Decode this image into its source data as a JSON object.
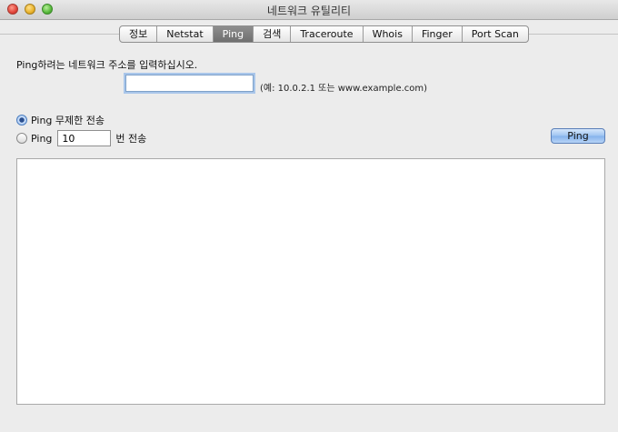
{
  "window": {
    "title": "네트워크 유틸리티"
  },
  "tabs": [
    {
      "label": "정보"
    },
    {
      "label": "Netstat"
    },
    {
      "label": "Ping"
    },
    {
      "label": "검색"
    },
    {
      "label": "Traceroute"
    },
    {
      "label": "Whois"
    },
    {
      "label": "Finger"
    },
    {
      "label": "Port Scan"
    }
  ],
  "active_tab": "Ping",
  "ping": {
    "prompt": "Ping하려는 네트워크 주소를 입력하십시오.",
    "address_value": "",
    "address_placeholder": "",
    "hint": "(예: 10.0.2.1 또는 www.example.com)",
    "unlimited_label": "Ping 무제한 전송",
    "count_prefix": "Ping",
    "count_value": "10",
    "count_suffix": "번 전송",
    "selected_mode": "unlimited",
    "button_label": "Ping",
    "output_text": ""
  },
  "icons": {
    "close": "close-icon",
    "minimize": "minimize-icon",
    "zoom": "zoom-icon"
  }
}
